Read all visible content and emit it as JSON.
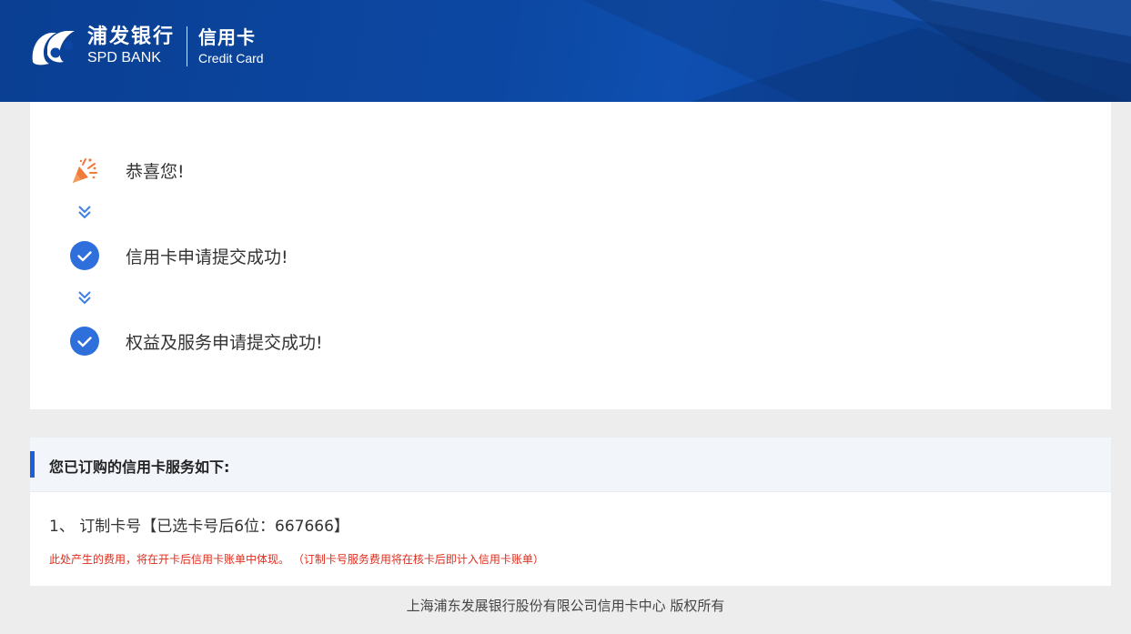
{
  "header": {
    "bank_name_cn": "浦发银行",
    "bank_name_en": "SPD BANK",
    "product_cn": "信用卡",
    "product_en": "Credit Card",
    "logo_icon": "spd-logo-icon",
    "colors": {
      "header_bg": "#0c48a3",
      "accent": "#1d5fd6"
    }
  },
  "status": {
    "steps": [
      {
        "icon": "party-popper-icon",
        "label": "恭喜您!"
      },
      {
        "icon": "check-circle-icon",
        "label": "信用卡申请提交成功!"
      },
      {
        "icon": "check-circle-icon",
        "label": "权益及服务申请提交成功!"
      }
    ],
    "connector_icon": "double-chevron-down-icon"
  },
  "services": {
    "title": "您已订购的信用卡服务如下:",
    "item": "1、 订制卡号【已选卡号后6位：667666】",
    "note": "此处产生的费用，将在开卡后信用卡账单中体现。 （订制卡号服务费用将在核卡后即计入信用卡账单）",
    "note_color": "#e12b1c"
  },
  "footer": {
    "copyright": "上海浦东发展银行股份有限公司信用卡中心 版权所有"
  }
}
